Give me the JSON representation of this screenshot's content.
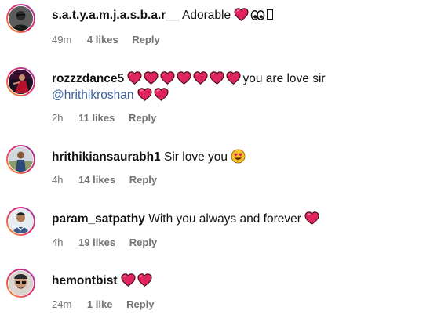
{
  "comments": [
    {
      "username": "s.a.t.y.a.m.j.a.s.b.a.r__",
      "text": "Adorable",
      "emojis_after": [
        "red-heart-icon",
        "eyes-icon",
        "missing-glyph-box-icon"
      ],
      "time": "49m",
      "likes": "4 likes",
      "reply": "Reply"
    },
    {
      "username": "rozzzdance5",
      "hearts_before": 7,
      "text": "you are love sir",
      "mention": "@hrithikroshan",
      "hearts_after": 2,
      "time": "2h",
      "likes": "11 likes",
      "reply": "Reply"
    },
    {
      "username": "hrithikiansaurabh1",
      "text": "Sir love you",
      "emojis_after": [
        "heart-eyes-face-icon"
      ],
      "time": "4h",
      "likes": "14 likes",
      "reply": "Reply"
    },
    {
      "username": "param_satpathy",
      "text": "With you always and forever",
      "emojis_after": [
        "red-heart-icon"
      ],
      "time": "4h",
      "likes": "19 likes",
      "reply": "Reply"
    },
    {
      "username": "hemontbist",
      "hearts_after": 2,
      "time": "24m",
      "likes": "1 like",
      "reply": "Reply"
    }
  ],
  "colors": {
    "username": "#111111",
    "meta": "#737373",
    "mention": "#3b5f9e",
    "heart": "#e0245e",
    "story_ring_start": "#f9a825",
    "story_ring_end": "#833ab4"
  }
}
